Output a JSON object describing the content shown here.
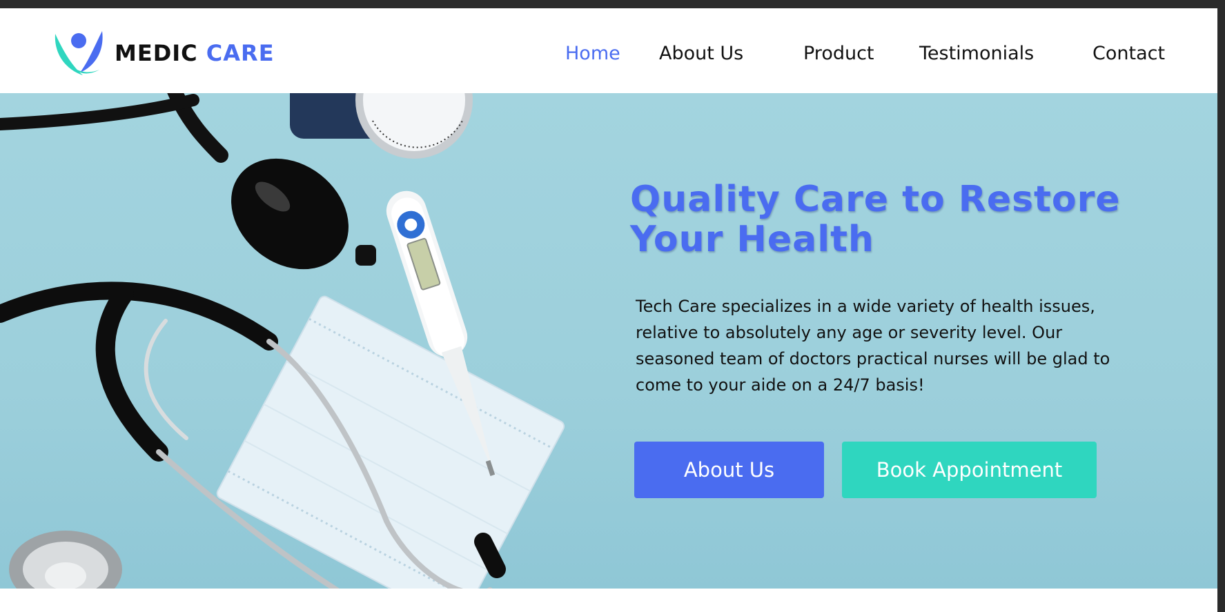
{
  "brand": {
    "name": "MEDIC",
    "accent": "CARE",
    "logo_icon": "person-leaf-logo-icon"
  },
  "nav": {
    "items": [
      {
        "label": "Home",
        "active": true
      },
      {
        "label": "About Us",
        "active": false
      },
      {
        "label": "Product",
        "active": false
      },
      {
        "label": "Testimonials",
        "active": false
      },
      {
        "label": "Contact",
        "active": false
      }
    ]
  },
  "hero": {
    "title": "Quality Care to Restore Your Health",
    "description": "Tech Care specializes in a wide variety of health issues, relative to absolutely any age or severity level. Our seasoned team of doctors practical nurses will be glad to come to your aide on a 24/7 basis!",
    "about_button": "About Us",
    "book_button": "Book Appointment",
    "image_subject": "stethoscope-thermometer-mask-photo"
  },
  "colors": {
    "accent_blue": "#4a6cf0",
    "accent_teal": "#2fd6bf",
    "hero_bg": "#a3d4df",
    "text": "#111111"
  }
}
